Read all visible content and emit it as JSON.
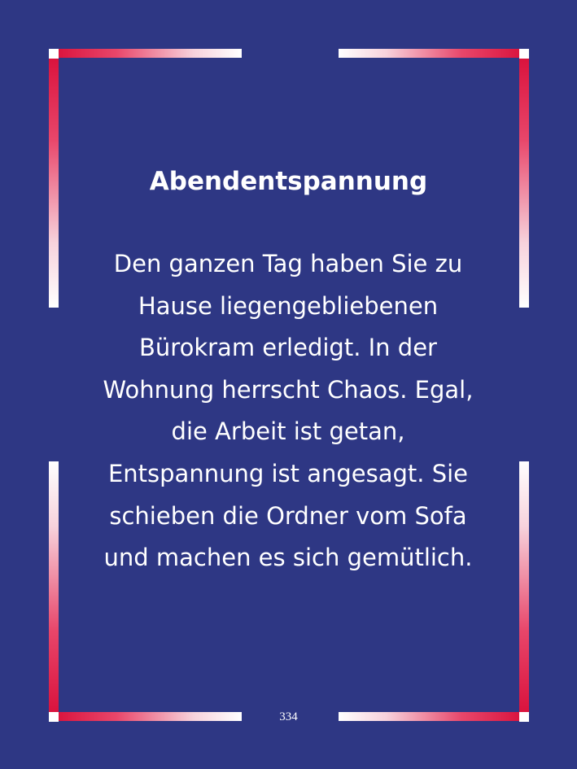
{
  "page": {
    "title": "Abendentspannung",
    "body_lines": [
      " Den ganzen Tag haben Sie zu",
      "Hause liegengebliebenen",
      "Bürokram erledigt. In der",
      "Wohnung herrscht Chaos. Egal,",
      "die Arbeit ist getan,",
      "Entspannung ist angesagt. Sie",
      "schieben die Ordner vom Sofa",
      "und machen es sich gemütlich."
    ],
    "page_number": "334"
  },
  "colors": {
    "background": "#2e3784",
    "frame_red": "#d80d38",
    "frame_white": "#ffffff",
    "text": "#ffffff"
  }
}
